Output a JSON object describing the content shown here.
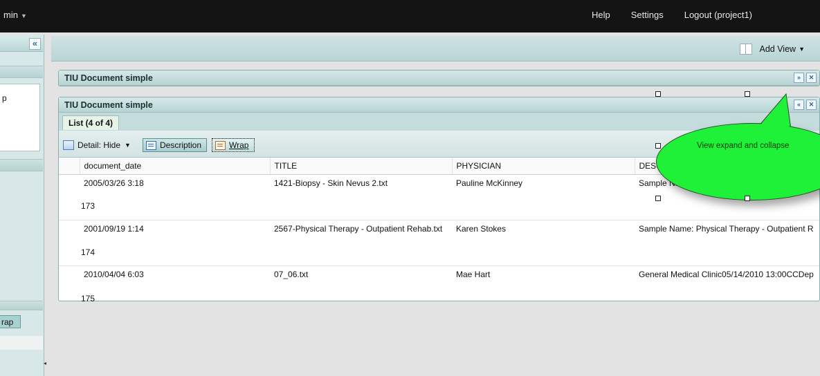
{
  "topbar": {
    "app_menu": "min",
    "nav": [
      "Help",
      "Settings",
      "Logout (project1)"
    ]
  },
  "sidebar": {
    "collapse_glyph": "«",
    "partial_text": "p",
    "wrap_button_partial": "rap"
  },
  "viewbar": {
    "add_view_label": "Add View"
  },
  "panel1": {
    "title": "TIU Document simple"
  },
  "panel2": {
    "title": "TIU Document simple",
    "tab_label": "List (4 of 4)",
    "toolbar": {
      "detail_label": "Detail: Hide",
      "description_label": "Description",
      "wrap_label": "Wrap"
    },
    "columns": [
      "document_date",
      "TITLE",
      "PHYSICIAN",
      "DESC"
    ],
    "rows": [
      {
        "date": "2005/03/26 3:18",
        "id": "173",
        "title": "1421-Biopsy - Skin Nevus 2.txt",
        "physician": "Pauline McKinney",
        "desc": "Sample Na"
      },
      {
        "date": "2001/09/19 1:14",
        "id": "174",
        "title": "2567-Physical Therapy - Outpatient Rehab.txt",
        "physician": "Karen Stokes",
        "desc": "Sample Name: Physical Therapy - Outpatient R"
      },
      {
        "date": "2010/04/04 6:03",
        "id": "175",
        "title": "07_06.txt",
        "physician": "Mae Hart",
        "desc": "General Medical Clinic05/14/2010 13:00CCDep"
      }
    ]
  },
  "callout": {
    "text": "View expand and collapse",
    "color": "#1ef138"
  },
  "icons": [
    "chevron-down-icon",
    "double-chevron-left-icon",
    "columns-icon",
    "expand-icon",
    "collapse-icon",
    "close-icon",
    "grid-icon",
    "description-icon",
    "wrap-icon"
  ]
}
